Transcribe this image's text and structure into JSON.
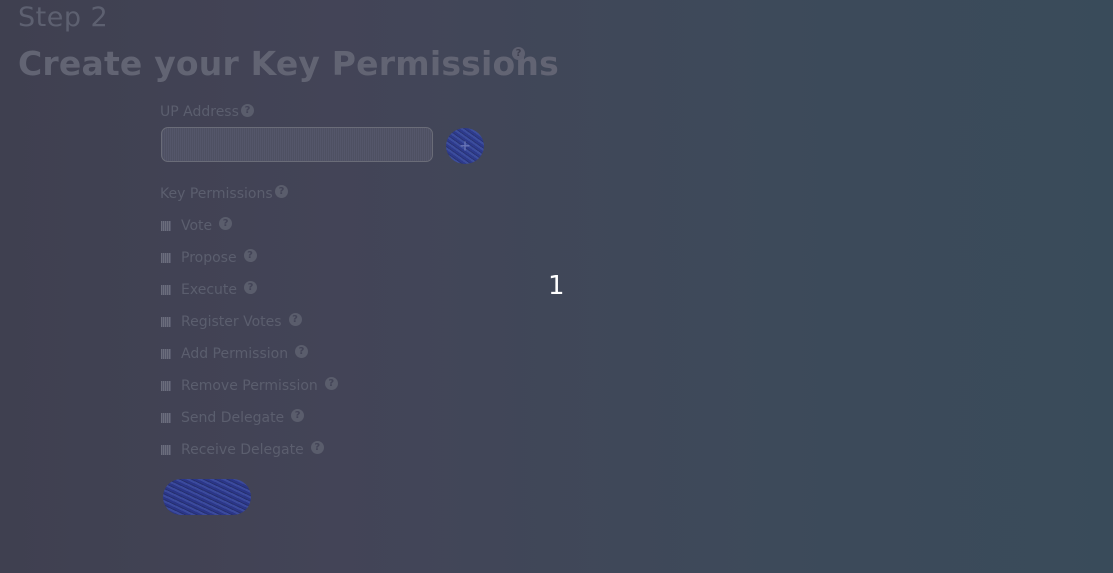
{
  "header": {
    "step": "Step 2",
    "title": "Create your Key Permissions",
    "title_help_icon": "question-circle-icon"
  },
  "up_address": {
    "label": "UP Address",
    "value": "",
    "add_icon": "add-icon"
  },
  "key_permissions": {
    "label": "Key Permissions",
    "items": [
      {
        "label": "Vote",
        "checked": false
      },
      {
        "label": "Propose",
        "checked": false
      },
      {
        "label": "Execute",
        "checked": false
      },
      {
        "label": "Register Votes",
        "checked": false
      },
      {
        "label": "Add Permission",
        "checked": false
      },
      {
        "label": "Remove Permission",
        "checked": false
      },
      {
        "label": "Send Delegate",
        "checked": false
      },
      {
        "label": "Receive Delegate",
        "checked": false
      }
    ]
  },
  "submit": {
    "label": ""
  },
  "overlay": {
    "number": "1"
  },
  "colors": {
    "background_left": "#3f4050",
    "background_right": "#394b5a",
    "button_blue": "#2d3a8c",
    "overlay_text": "#ffffff"
  }
}
